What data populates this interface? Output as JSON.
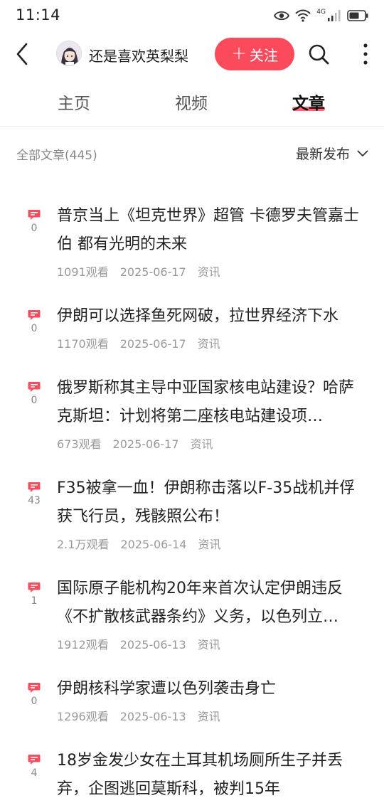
{
  "status_bar": {
    "time": "11:14",
    "network": "4G"
  },
  "header": {
    "account_name": "还是喜欢英梨梨",
    "follow_label": "关注"
  },
  "tabs": [
    {
      "label": "主页",
      "active": false
    },
    {
      "label": "视频",
      "active": false
    },
    {
      "label": "文章",
      "active": true
    }
  ],
  "filter": {
    "all_label": "全部文章(445)",
    "sort_label": "最新发布"
  },
  "articles": [
    {
      "title": "普京当上《坦克世界》超管 卡德罗夫管嘉士伯 都有光明的未来",
      "views": "1091观看",
      "date": "2025-06-17",
      "category": "资讯",
      "comments": "0"
    },
    {
      "title": "伊朗可以选择鱼死网破，拉世界经济下水",
      "views": "1170观看",
      "date": "2025-06-17",
      "category": "资讯",
      "comments": "0"
    },
    {
      "title": "俄罗斯称其主导中亚国家核电站建设？哈萨克斯坦：计划将第二座核电站建设项…",
      "views": "673观看",
      "date": "2025-06-17",
      "category": "资讯",
      "comments": "0"
    },
    {
      "title": "F35被拿一血！伊朗称击落以F-35战机并俘获飞行员，残骸照公布！",
      "views": "2.1万观看",
      "date": "2025-06-14",
      "category": "资讯",
      "comments": "43"
    },
    {
      "title": "国际原子能机构20年来首次认定伊朗违反《不扩散核武器条约》义务，以色列立…",
      "views": "1912观看",
      "date": "2025-06-13",
      "category": "资讯",
      "comments": "1"
    },
    {
      "title": "伊朗核科学家遭以色列袭击身亡",
      "views": "1296观看",
      "date": "2025-06-13",
      "category": "资讯",
      "comments": "0"
    },
    {
      "title": "18岁金发少女在土耳其机场厕所生子并丢弃，企图逃回莫斯科，被判15年",
      "views": "",
      "date": "",
      "category": "",
      "comments": "4"
    }
  ],
  "colors": {
    "accent": "#fa4a5b",
    "text": "#222222",
    "meta": "#999999"
  }
}
